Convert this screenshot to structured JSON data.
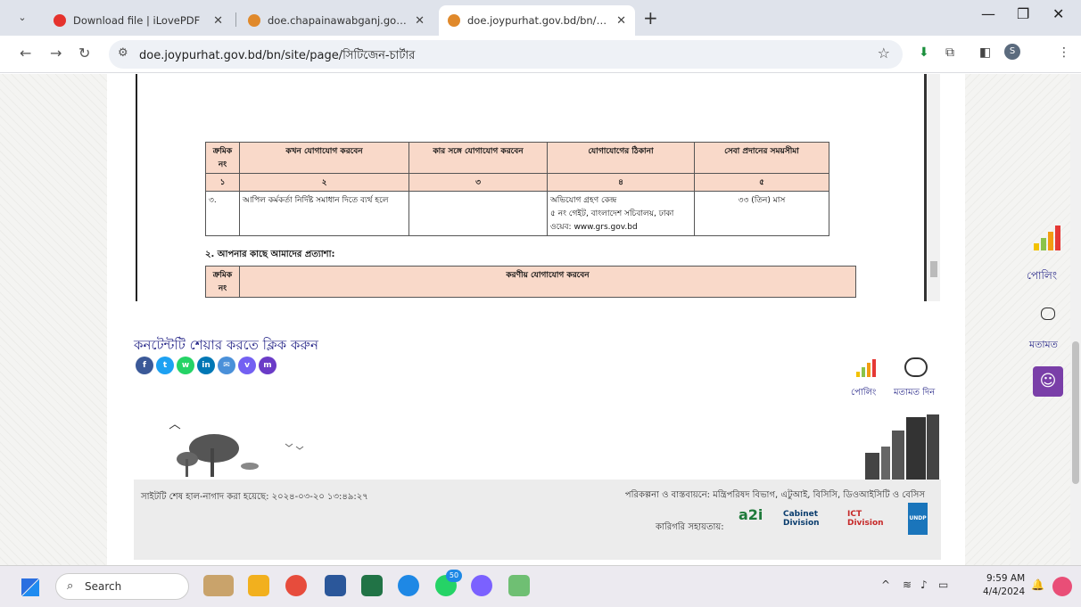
{
  "browser": {
    "tabs": [
      {
        "title": "Download file | iLovePDF",
        "active": false
      },
      {
        "title": "doe.chapainawabganj.gov.bd/b",
        "active": false
      },
      {
        "title": "doe.joypurhat.gov.bd/bn/site/p",
        "active": true
      }
    ],
    "url": "doe.joypurhat.gov.bd/bn/site/page/সিটিজেন-চার্টার"
  },
  "document": {
    "table1": {
      "headers": [
        "ক্রমিক নং",
        "কখন যোগাযোগ করবেন",
        "কার সঙ্গে যোগাযোগ করবেন",
        "যোগাযোগের ঠিকানা",
        "সেবা প্রদানের সময়সীমা"
      ],
      "numbers": [
        "১",
        "২",
        "৩",
        "৪",
        "৫"
      ],
      "row": {
        "serial": "৩.",
        "when": "আপিল কর্মকর্তা নির্দিষ্ট সমাধান দিতে ব্যর্থ হলে",
        "who": "",
        "address_line1": "অভিযোগ গ্রহণ কেন্দ্র",
        "address_line2": "৫ নং গেইট, বাংলাদেশ সচিবালয়, ঢাকা",
        "address_line3": "ওয়েব: www.grs.gov.bd",
        "timeline": "৩৩ (তিন) মাস"
      }
    },
    "section2_title": "২. আপনার কাছে আমাদের প্রত্যাশা:",
    "table2": {
      "headers": [
        "ক্রমিক নং",
        "করণীয় যোগাযোগ করবেন"
      ]
    }
  },
  "share": {
    "title": "কনটেন্টটি শেয়ার করতে ক্লিক করুন"
  },
  "poll": {
    "poll_label": "পোলিং",
    "comment_label": "মতামত দিন"
  },
  "right_widget": {
    "poll": "পোলিং",
    "mot": "মতামত"
  },
  "footer": {
    "updated": "সাইটটি শেষ হাল-নাগাদ করা হয়েছে: ২০২৪-০৩-২০ ১৩:৪৯:২৭",
    "implementation": "পরিকল্পনা ও বাস্তবায়নে: মন্ত্রিপরিষদ বিভাগ, এটুআই, বিসিসি, ডিওআইসিটি ও বেসিস",
    "tech_support": "কারিগরি সহায়তায়:",
    "logos": [
      "a2i",
      "Cabinet Division",
      "ICT Division",
      "UNDP"
    ]
  },
  "taskbar": {
    "search_label": "Search",
    "time": "9:59 AM",
    "date": "4/4/2024",
    "badge": "50"
  },
  "colors": {
    "accent_purple": "#7a3fa8",
    "link_blue": "#2a2a8a",
    "table_header": "#f9d9c9"
  }
}
